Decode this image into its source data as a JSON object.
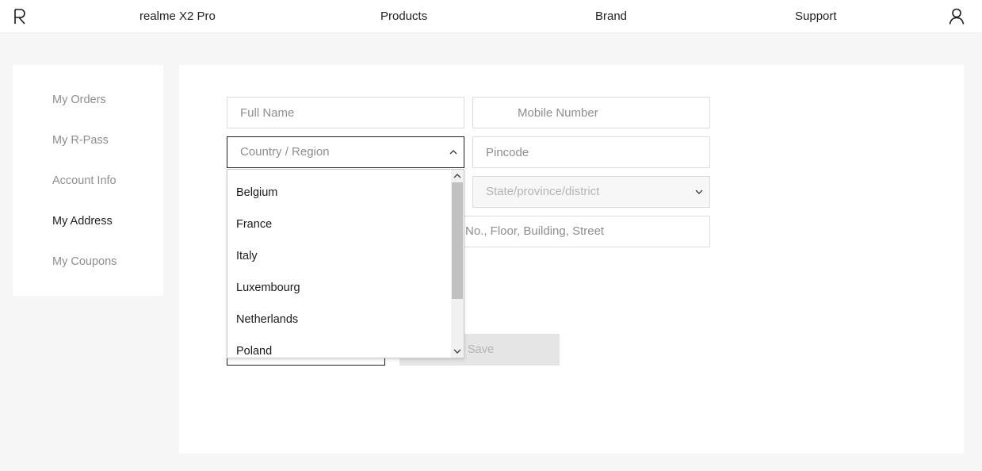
{
  "header": {
    "nav": [
      "realme X2 Pro",
      "Products",
      "Brand",
      "Support"
    ]
  },
  "sidebar": {
    "items": [
      "My Orders",
      "My R-Pass",
      "Account Info",
      "My Address",
      "My Coupons"
    ],
    "active": "My Address"
  },
  "form": {
    "full_name_placeholder": "Full Name",
    "mobile_placeholder": "Mobile Number",
    "country_placeholder": "Country / Region",
    "pincode_placeholder": "Pincode",
    "state_placeholder": "State/province/district",
    "address_placeholder": "No., Floor, Building, Street",
    "save_label": "Save"
  },
  "country_dropdown": {
    "options": [
      "Belgium",
      "France",
      "Italy",
      "Luxembourg",
      "Netherlands",
      "Poland"
    ]
  },
  "colors": {
    "accent_border": "#1f1f1f",
    "muted_text": "#8e8e8e",
    "page_bg": "#f6f6f6"
  }
}
